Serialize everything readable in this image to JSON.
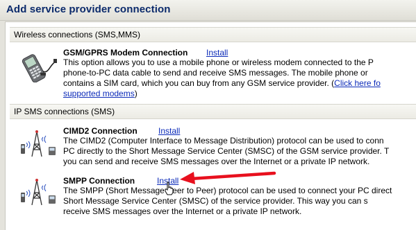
{
  "window": {
    "title": "Add service provider connection"
  },
  "sections": [
    {
      "header": "Wireless connections (SMS,MMS)"
    },
    {
      "header": "IP SMS connections (SMS)"
    }
  ],
  "gsm": {
    "name": "GSM/GPRS Modem Connection",
    "install_label": "Install",
    "desc_line1": "This option allows you to use a mobile phone or wireless modem connected to the P",
    "desc_line2": "phone-to-PC data cable to send and receive SMS messages. The mobile phone or",
    "desc_line3": "contains a SIM card, which you can buy from any GSM service provider. (",
    "link_text_1": "Click here fo",
    "link_text_2": "supported modems",
    "desc_tail": ")",
    "icon": "mobile-phone-modem-icon"
  },
  "cimd2": {
    "name": "CIMD2 Connection",
    "install_label": "Install",
    "desc_line1": "The CIMD2 (Computer Interface to Message Distribution) protocol can be used to conn",
    "desc_line2": "PC directly to the Short Message Service Center (SMSC) of the GSM service provider. T",
    "desc_line3": "you can send and receive SMS messages over the Internet or a private IP network.",
    "icon": "antenna-tower-icon"
  },
  "smpp": {
    "name": "SMPP Connection",
    "install_label": "Install",
    "desc_line1": "The SMPP (Short Message Peer to Peer) protocol can be used to connect your PC direct",
    "desc_line2": "Short Message Service Center (SMSC) of the service provider. This way you can s",
    "desc_line3": "receive SMS messages over the Internet or a private IP network.",
    "icon": "antenna-tower-icon"
  },
  "colors": {
    "link": "#0a29b8",
    "title": "#0b2a6b",
    "arrow": "#e8101e"
  }
}
